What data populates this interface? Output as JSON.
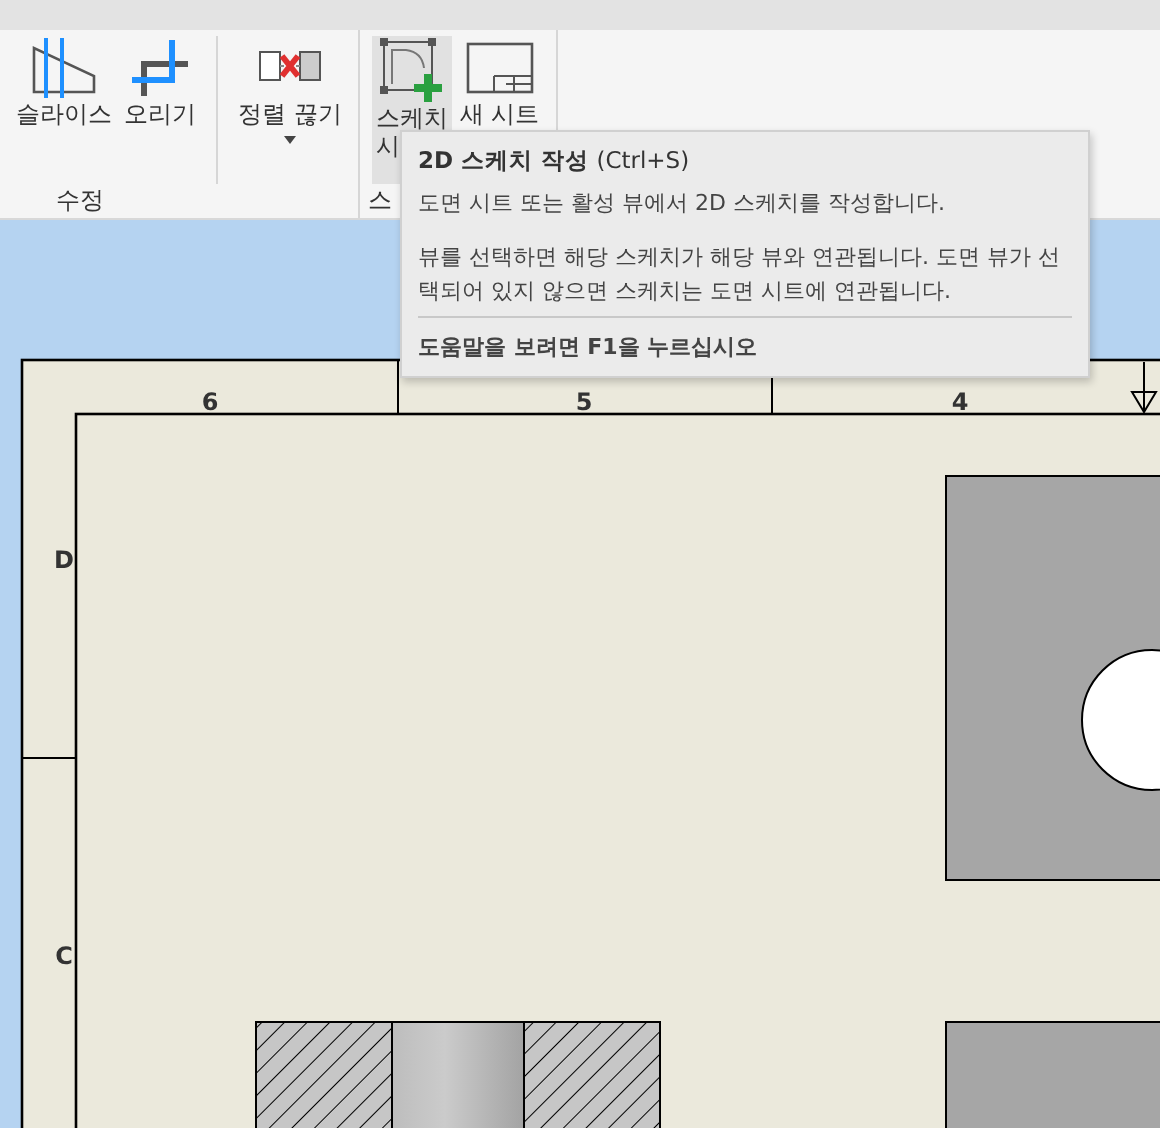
{
  "ribbon": {
    "groups": [
      {
        "label": "수정",
        "sections": [
          [
            {
              "kind": "slice",
              "label": [
                "슬라이스"
              ],
              "selected": false,
              "dropdown": false
            },
            {
              "kind": "crop",
              "label": [
                "오리기"
              ],
              "selected": false,
              "dropdown": false
            }
          ],
          [
            {
              "kind": "break",
              "label": [
                "정렬 끊기"
              ],
              "selected": false,
              "dropdown": true
            }
          ]
        ]
      },
      {
        "label": "스",
        "sections": [
          [
            {
              "kind": "sketch",
              "label": [
                "스케치",
                "시"
              ],
              "selected": true,
              "dropdown": false
            },
            {
              "kind": "sheet",
              "label": [
                "새 시트"
              ],
              "selected": false,
              "dropdown": false
            }
          ]
        ]
      }
    ]
  },
  "tooltip": {
    "title": "**2D 스케치 작성** (Ctrl+S)",
    "paragraphs": [
      "도면 시트 또는 활성 뷰에서 2D 스케치를 작성합니다.",
      "뷰를 선택하면 해당 스케치가 해당 뷰와 연관됩니다. 도면 뷰가 선택되어 있지 않으면 스케치는 도면 시트에 연관됩니다."
    ],
    "help": "도움말을 보려면 F1을 누르십시오"
  },
  "drawing": {
    "column_numbers": [
      "6",
      "5",
      "4"
    ],
    "row_letters": [
      "D",
      "C"
    ]
  }
}
